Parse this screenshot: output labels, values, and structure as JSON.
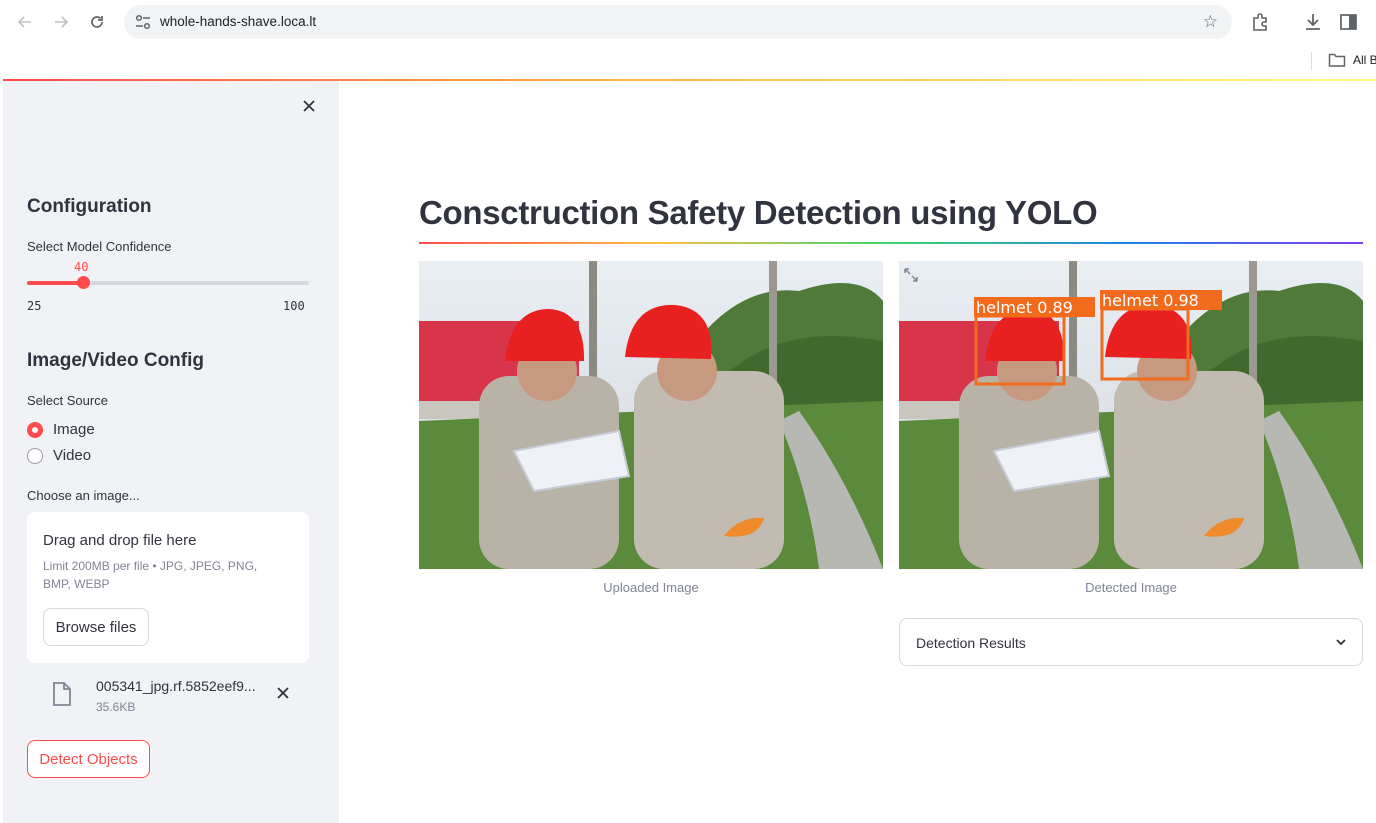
{
  "browser": {
    "url": "whole-hands-shave.loca.lt",
    "bookmarks_label": "All B"
  },
  "sidebar": {
    "config_heading": "Configuration",
    "confidence_label": "Select Model Confidence",
    "slider": {
      "value": "40",
      "min": "25",
      "max": "100",
      "value_num": 40,
      "min_num": 25,
      "max_num": 100
    },
    "source_heading": "Image/Video Config",
    "source_label": "Select Source",
    "sources": [
      {
        "label": "Image",
        "selected": true
      },
      {
        "label": "Video",
        "selected": false
      }
    ],
    "uploader_label": "Choose an image...",
    "dropzone_title": "Drag and drop file here",
    "dropzone_limit": "Limit 200MB per file • JPG, JPEG, PNG, BMP, WEBP",
    "browse_label": "Browse files",
    "file": {
      "name": "005341_jpg.rf.5852eef9...",
      "size": "35.6KB"
    },
    "detect_label": "Detect Objects"
  },
  "main": {
    "title": "Consctruction Safety Detection using YOLO",
    "uploaded_caption": "Uploaded Image",
    "detected_caption": "Detected Image",
    "detections": [
      {
        "label": "helmet 0.89"
      },
      {
        "label": "helmet 0.98"
      }
    ],
    "results_label": "Detection Results"
  },
  "colors": {
    "accent": "#ff4b4b",
    "sidebar_bg": "#f0f2f6",
    "text": "#31333f",
    "muted": "#808495",
    "detection": "#f26b1d"
  }
}
